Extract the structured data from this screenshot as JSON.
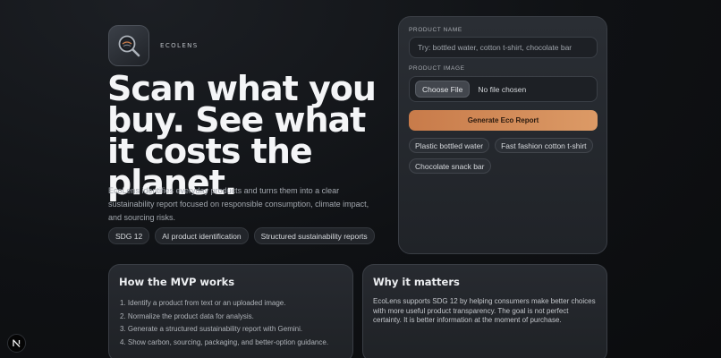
{
  "brand": {
    "name": "ECOLENS",
    "logo_icon": "magnifier-globe-icon"
  },
  "hero": {
    "headline": "Scan what you buy. See what it costs the planet.",
    "intro": "EcoLens identifies everyday products and turns them into a clear sustainability report focused on responsible consumption, climate impact, and sourcing risks.",
    "chips": [
      "SDG 12",
      "AI product identification",
      "Structured sustainability reports"
    ]
  },
  "form": {
    "product_name_label": "PRODUCT NAME",
    "product_name_placeholder": "Try: bottled water, cotton t-shirt, chocolate bar",
    "product_name_value": "",
    "product_image_label": "PRODUCT IMAGE",
    "choose_file_label": "Choose File",
    "file_status": "No file chosen",
    "generate_label": "Generate Eco Report",
    "samples": [
      "Plastic bottled water",
      "Fast fashion cotton t-shirt",
      "Chocolate snack bar"
    ]
  },
  "mvp": {
    "title": "How the MVP works",
    "steps": [
      "1. Identify a product from text or an uploaded image.",
      "2. Normalize the product data for analysis.",
      "3. Generate a structured sustainability report with Gemini.",
      "4. Show carbon, sourcing, packaging, and better-option guidance."
    ]
  },
  "why": {
    "title": "Why it matters",
    "body": "EcoLens supports SDG 12 by helping consumers make better choices with more useful product transparency. The goal is not perfect certainty. It is better information at the moment of purchase."
  },
  "dev_badge": {
    "letter": "N",
    "icon": "nextjs-dev-icon"
  },
  "colors": {
    "accent": "#d08a57",
    "background": "#0f1114",
    "card": "#24272c"
  }
}
